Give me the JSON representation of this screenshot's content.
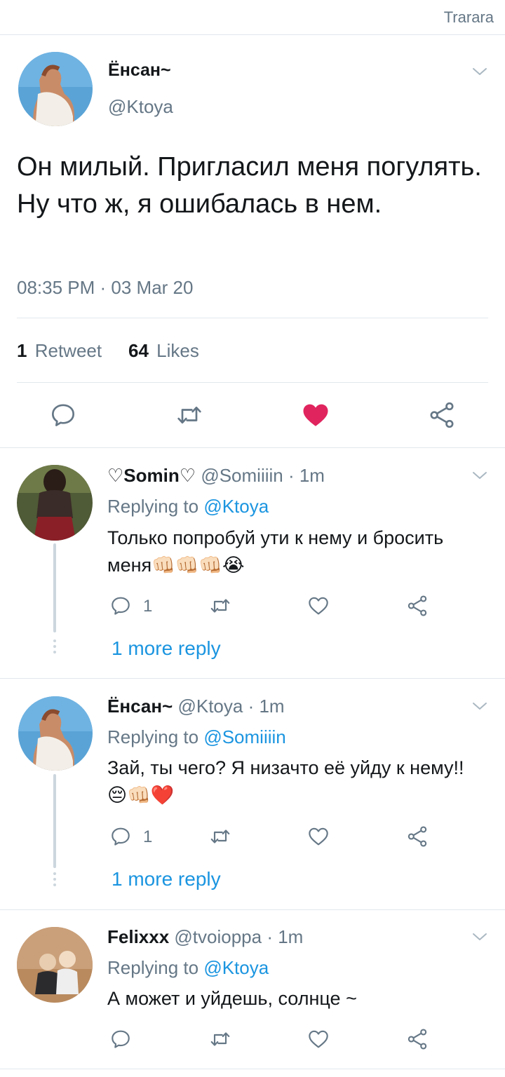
{
  "topbar": {
    "label": "Trarara"
  },
  "main_tweet": {
    "name": "Ёнсан~",
    "handle": "@Ktoya",
    "text": "Он милый. Пригласил меня погулять. Ну что ж, я ошибалась в нем.",
    "timestamp": "08:35 PM · 03 Mar 20",
    "retweets_count": "1",
    "retweets_label": "Retweet",
    "likes_count": "64",
    "likes_label": "Likes",
    "liked": true,
    "colors": {
      "like": "#e0245e",
      "icon": "#657786"
    }
  },
  "replies": [
    {
      "name": "♡Somin♡",
      "handle": "@Somiiiin",
      "time": "· 1m",
      "replying_prefix": "Replying to",
      "replying_to": "@Ktoya",
      "text": "Только попробуй ути к нему и бросить меня👊🏻👊🏻👊🏻😭",
      "reply_count": "1",
      "more_replies": "1 more reply"
    },
    {
      "name": "Ёнсан~",
      "handle": "@Ktoya",
      "time": "· 1m",
      "replying_prefix": "Replying to",
      "replying_to": "@Somiiiin",
      "text": "Зай, ты чего? Я низачто её уйду к нему!! 😔👊🏻❤️",
      "reply_count": "1",
      "more_replies": "1 more reply"
    },
    {
      "name": "Felixxx",
      "handle": "@tvoioppa",
      "time": "· 1m",
      "replying_prefix": "Replying to",
      "replying_to": "@Ktoya",
      "text": "А может и уйдешь, солнце ~",
      "reply_count": ""
    }
  ]
}
